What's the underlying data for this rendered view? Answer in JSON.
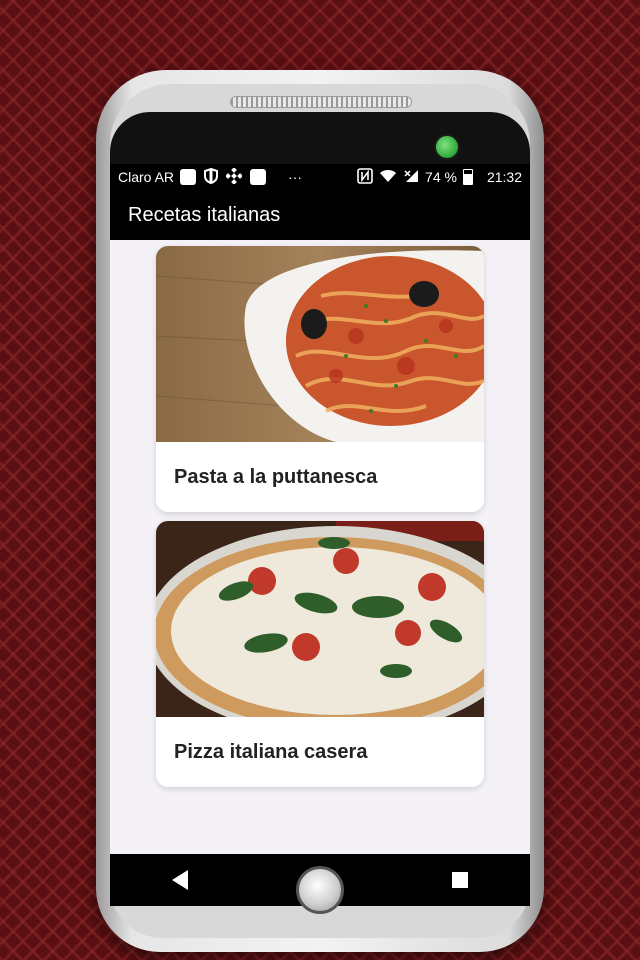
{
  "status_bar": {
    "carrier": "Claro AR",
    "more": "···",
    "battery_level": "74 %",
    "time": "21:32",
    "icons": [
      "app-notification-icon",
      "shield-icon",
      "binance-icon",
      "app-notification-icon",
      "nfc-icon",
      "wifi-icon",
      "signal-icon",
      "battery-icon"
    ]
  },
  "app_bar": {
    "title": "Recetas italianas"
  },
  "recipes": [
    {
      "title": "Pasta a la puttanesca",
      "image": "pasta-puttanesca-photo"
    },
    {
      "title": "Pizza italiana casera",
      "image": "pizza-casera-photo"
    }
  ],
  "nav": [
    "back-icon",
    "home-icon",
    "recents-icon"
  ],
  "colors": {
    "background": "#5a0f12",
    "app_bar": "#000000",
    "list_bg": "#f4f2f7"
  }
}
